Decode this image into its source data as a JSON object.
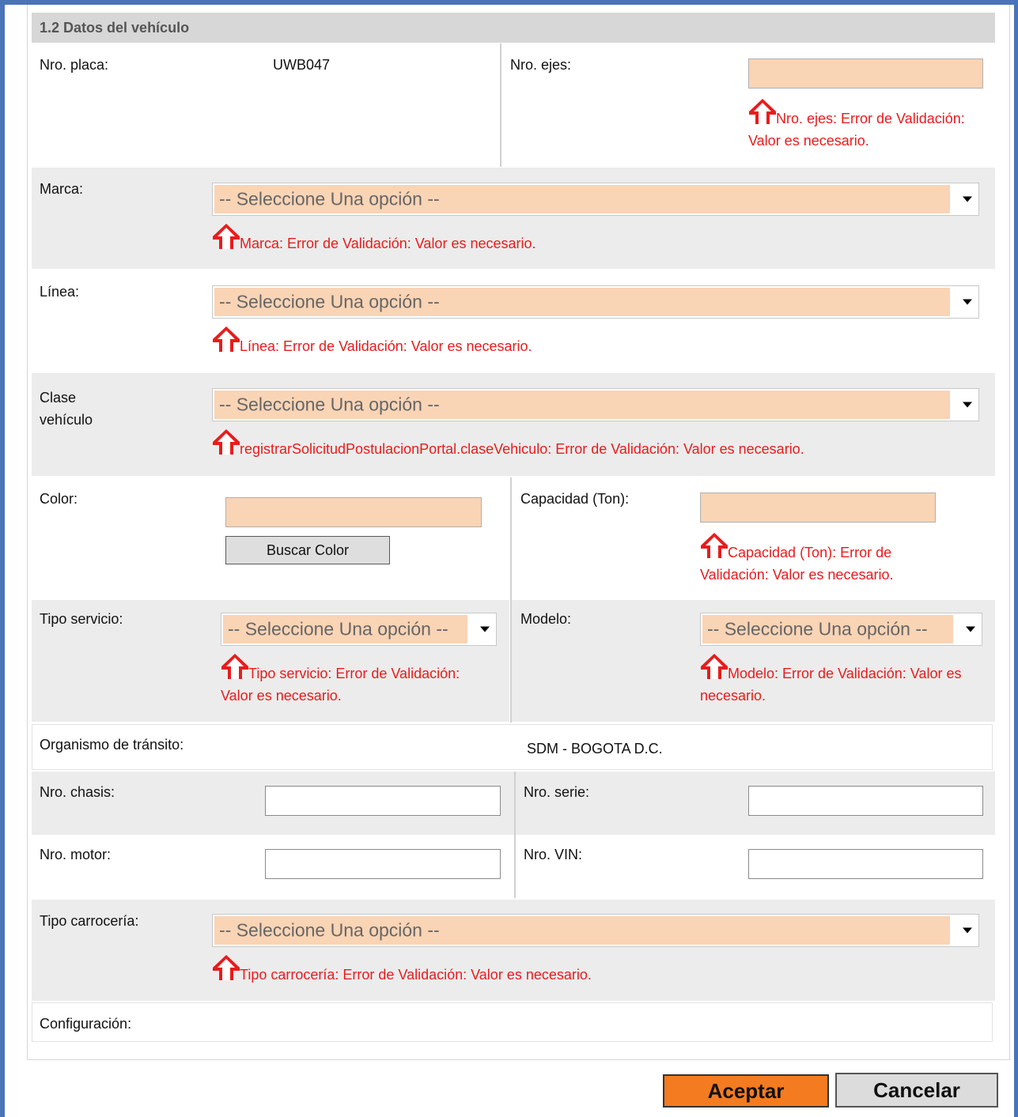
{
  "section_title": "1.2 Datos del vehículo",
  "placeholder_option": "-- Seleccione Una opción --",
  "placeholder_option_short": "-- Seleccione Una opción --",
  "fields": {
    "placa": {
      "label": "Nro. placa:",
      "value": "UWB047"
    },
    "ejes": {
      "label": "Nro. ejes:",
      "error": "Nro. ejes: Error de Validación: Valor es necesario."
    },
    "marca": {
      "label": "Marca:",
      "error": "Marca: Error de Validación: Valor es necesario."
    },
    "linea": {
      "label": "Línea:",
      "error": "Línea: Error de Validación: Valor es necesario."
    },
    "clase": {
      "label_line1": "Clase",
      "label_line2": "vehículo",
      "error": "registrarSolicitudPostulacionPortal.claseVehiculo: Error de Validación: Valor es necesario."
    },
    "color": {
      "label": "Color:",
      "button": "Buscar Color"
    },
    "capacidad": {
      "label": "Capacidad (Ton):",
      "error": "Capacidad (Ton): Error de Validación: Valor es necesario."
    },
    "tipo_servicio": {
      "label": "Tipo servicio:",
      "error": "Tipo servicio: Error de Validación: Valor es necesario."
    },
    "modelo": {
      "label": "Modelo:",
      "error": "Modelo: Error de Validación: Valor es necesario."
    },
    "organismo": {
      "label": "Organismo de tránsito:",
      "value": "SDM - BOGOTA D.C."
    },
    "chasis": {
      "label": "Nro. chasis:",
      "value": ""
    },
    "serie": {
      "label": "Nro. serie:",
      "value": ""
    },
    "motor": {
      "label": "Nro. motor:",
      "value": ""
    },
    "vin": {
      "label": "Nro. VIN:",
      "value": ""
    },
    "carroceria": {
      "label": "Tipo carrocería:",
      "error": "Tipo carrocería: Error de Validación: Valor es necesario."
    },
    "configuracion": {
      "label": "Configuración:"
    }
  },
  "buttons": {
    "accept": "Aceptar",
    "cancel": "Cancelar"
  },
  "colors": {
    "error_text": "#e81c1c",
    "error_fill": "#f9d4b5",
    "accept_bg": "#f47b20",
    "frame": "#4a74b8"
  },
  "icons": {
    "error": "error-arrow-icon"
  }
}
